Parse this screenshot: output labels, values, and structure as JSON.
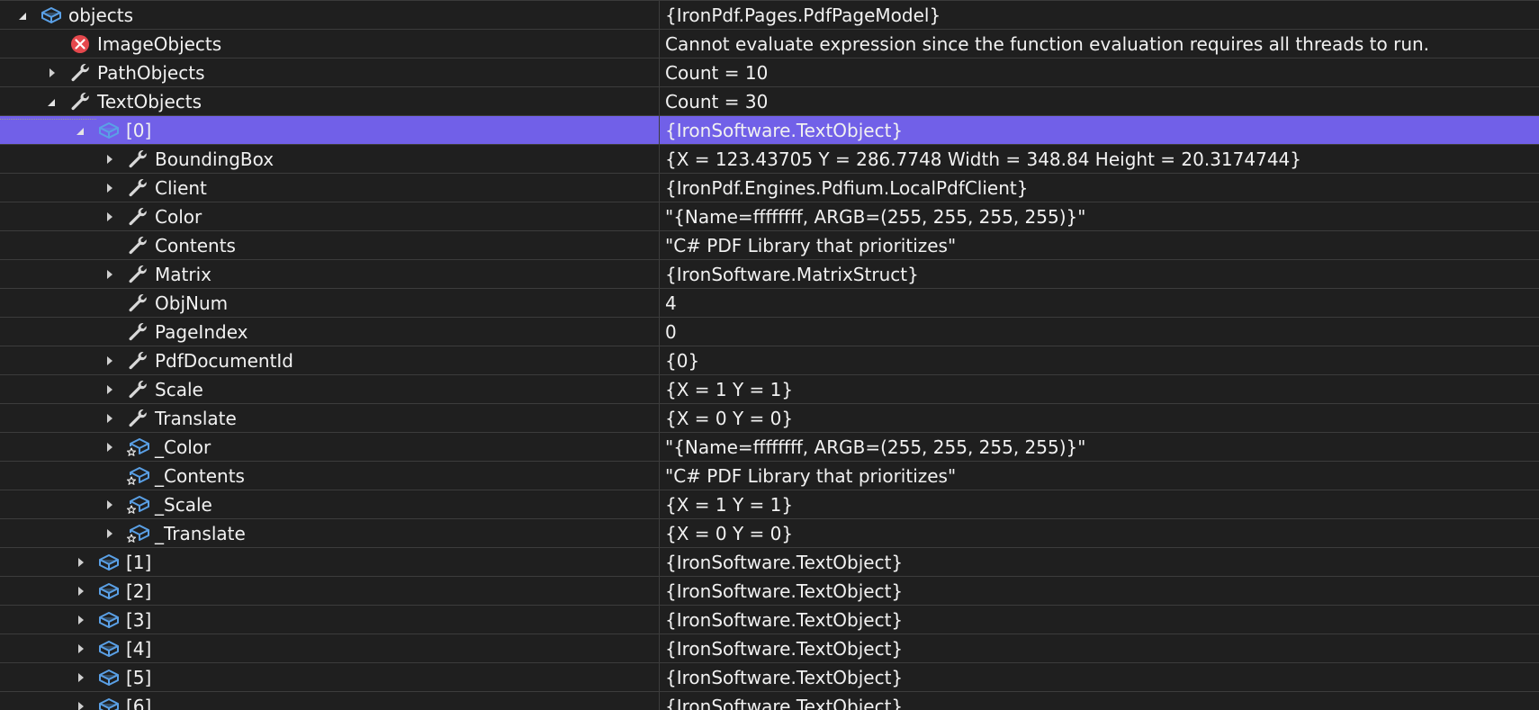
{
  "rows": [
    {
      "name": "objects",
      "value": "{IronPdf.Pages.PdfPageModel}",
      "level": 0,
      "expander": "expanded",
      "icon": "object-icon"
    },
    {
      "name": "ImageObjects",
      "value": "Cannot evaluate expression since the function evaluation requires all threads to run.",
      "level": 1,
      "expander": "none",
      "icon": "error-icon"
    },
    {
      "name": "PathObjects",
      "value": "Count = 10",
      "level": 1,
      "expander": "collapsed",
      "icon": "wrench-icon"
    },
    {
      "name": "TextObjects",
      "value": "Count = 30",
      "level": 1,
      "expander": "expanded",
      "icon": "wrench-icon"
    },
    {
      "name": "[0]",
      "value": "{IronSoftware.TextObject}",
      "level": 2,
      "expander": "expanded",
      "icon": "object-icon",
      "selected": true
    },
    {
      "name": "BoundingBox",
      "value": "{X = 123.43705 Y = 286.7748 Width = 348.84 Height = 20.3174744}",
      "level": 3,
      "expander": "collapsed",
      "icon": "wrench-icon"
    },
    {
      "name": "Client",
      "value": "{IronPdf.Engines.Pdfium.LocalPdfClient}",
      "level": 3,
      "expander": "collapsed",
      "icon": "wrench-icon"
    },
    {
      "name": "Color",
      "value": "\"{Name=ffffffff, ARGB=(255, 255, 255, 255)}\"",
      "level": 3,
      "expander": "collapsed",
      "icon": "wrench-icon"
    },
    {
      "name": "Contents",
      "value": "\"C# PDF Library that prioritizes\"",
      "level": 3,
      "expander": "none",
      "icon": "wrench-icon"
    },
    {
      "name": "Matrix",
      "value": "{IronSoftware.MatrixStruct}",
      "level": 3,
      "expander": "collapsed",
      "icon": "wrench-icon"
    },
    {
      "name": "ObjNum",
      "value": "4",
      "level": 3,
      "expander": "none",
      "icon": "wrench-icon"
    },
    {
      "name": "PageIndex",
      "value": "0",
      "level": 3,
      "expander": "none",
      "icon": "wrench-icon"
    },
    {
      "name": "PdfDocumentId",
      "value": "{0}",
      "level": 3,
      "expander": "collapsed",
      "icon": "wrench-icon"
    },
    {
      "name": "Scale",
      "value": "{X = 1 Y = 1}",
      "level": 3,
      "expander": "collapsed",
      "icon": "wrench-icon"
    },
    {
      "name": "Translate",
      "value": "{X = 0 Y = 0}",
      "level": 3,
      "expander": "collapsed",
      "icon": "wrench-icon"
    },
    {
      "name": "_Color",
      "value": "\"{Name=ffffffff, ARGB=(255, 255, 255, 255)}\"",
      "level": 3,
      "expander": "collapsed",
      "icon": "field-icon"
    },
    {
      "name": "_Contents",
      "value": "\"C# PDF Library that prioritizes\"",
      "level": 3,
      "expander": "none",
      "icon": "field-icon"
    },
    {
      "name": "_Scale",
      "value": "{X = 1 Y = 1}",
      "level": 3,
      "expander": "collapsed",
      "icon": "field-icon"
    },
    {
      "name": "_Translate",
      "value": "{X = 0 Y = 0}",
      "level": 3,
      "expander": "collapsed",
      "icon": "field-icon"
    },
    {
      "name": "[1]",
      "value": "{IronSoftware.TextObject}",
      "level": 2,
      "expander": "collapsed",
      "icon": "object-icon"
    },
    {
      "name": "[2]",
      "value": "{IronSoftware.TextObject}",
      "level": 2,
      "expander": "collapsed",
      "icon": "object-icon"
    },
    {
      "name": "[3]",
      "value": "{IronSoftware.TextObject}",
      "level": 2,
      "expander": "collapsed",
      "icon": "object-icon"
    },
    {
      "name": "[4]",
      "value": "{IronSoftware.TextObject}",
      "level": 2,
      "expander": "collapsed",
      "icon": "object-icon"
    },
    {
      "name": "[5]",
      "value": "{IronSoftware.TextObject}",
      "level": 2,
      "expander": "collapsed",
      "icon": "object-icon"
    },
    {
      "name": "[6]",
      "value": "{IronSoftware.TextObject}",
      "level": 2,
      "expander": "collapsed",
      "icon": "object-icon"
    }
  ],
  "colors": {
    "background": "#1f1f1f",
    "selection": "#7160e8",
    "gridline": "#3c3c3c",
    "text": "#f1f1f1",
    "object_icon": "#5aa0e6",
    "wrench_icon": "#d8d8d8",
    "error_icon": "#e5484d"
  }
}
